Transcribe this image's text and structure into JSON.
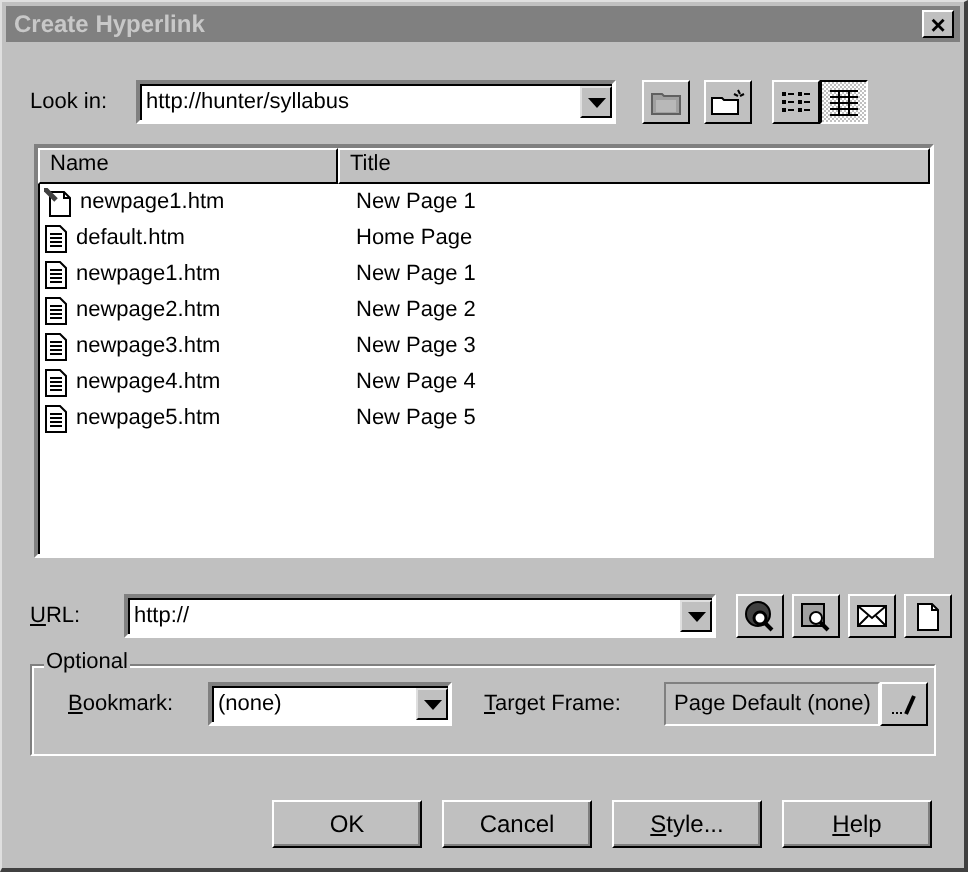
{
  "window": {
    "title": "Create Hyperlink",
    "close_glyph": "×"
  },
  "look_in": {
    "label": "Look in:",
    "value": "http://hunter/syllabus"
  },
  "view_buttons": [
    {
      "kind": "list",
      "selected": false
    },
    {
      "kind": "details",
      "selected": true
    }
  ],
  "table": {
    "columns": [
      "Name",
      "Title"
    ],
    "rows": [
      {
        "kind": "current",
        "name": "newpage1.htm",
        "title": "New Page 1"
      },
      {
        "kind": "file",
        "name": "default.htm",
        "title": "Home Page"
      },
      {
        "kind": "file",
        "name": "newpage1.htm",
        "title": "New Page 1"
      },
      {
        "kind": "file",
        "name": "newpage2.htm",
        "title": "New Page 2"
      },
      {
        "kind": "file",
        "name": "newpage3.htm",
        "title": "New Page 3"
      },
      {
        "kind": "file",
        "name": "newpage4.htm",
        "title": "New Page 4"
      },
      {
        "kind": "file",
        "name": "newpage5.htm",
        "title": "New Page 5"
      }
    ]
  },
  "url": {
    "label": "URL:",
    "access_key_underlined": true,
    "value": "http://"
  },
  "optional": {
    "title": "Optional",
    "bookmark": {
      "label": "Bookmark:",
      "access_key_underlined": true,
      "value": "(none)"
    },
    "target_frame": {
      "label": "Target Frame:",
      "access_key_underlined": true,
      "value": "Page Default (none)"
    }
  },
  "buttons": [
    {
      "label": "OK",
      "access_key_underlined": false
    },
    {
      "label": "Cancel",
      "access_key_underlined": false
    },
    {
      "label": "Style...",
      "access_key_underlined": true
    },
    {
      "label": "Help",
      "access_key_underlined": true
    }
  ]
}
